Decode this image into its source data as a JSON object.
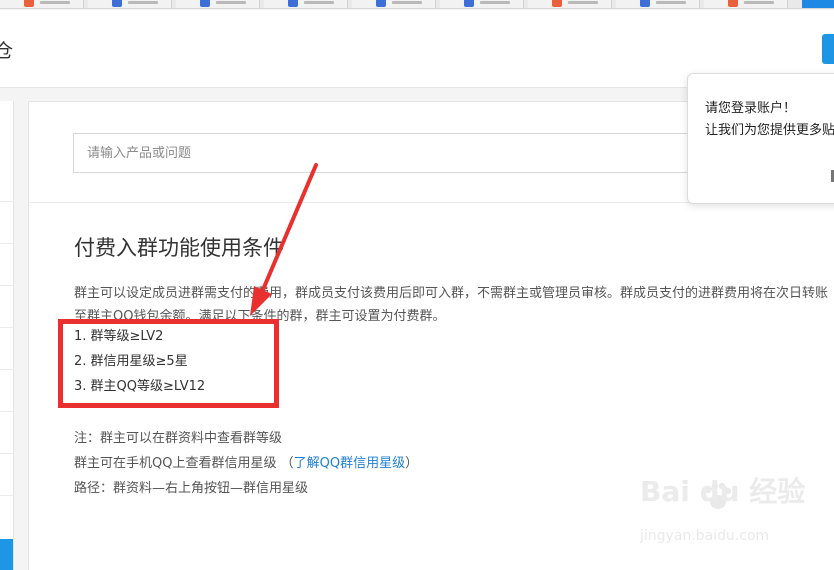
{
  "header": {
    "logo_fragment": "仓"
  },
  "search": {
    "placeholder": "请输入产品或问题"
  },
  "article": {
    "title": "付费入群功能使用条件",
    "intro": "群主可以设定成员进群需支付的费用，群成员支付该费用后即可入群，不需群主或管理员审核。群成员支付的进群费用将在次日转账至群主QQ钱包余额。满足以下条件的群，群主可设置为付费群。",
    "conditions": [
      "1. 群等级≥LV2",
      "2. 群信用星级≥5星",
      "3. 群主QQ等级≥LV12"
    ],
    "note_line1": "注：群主可以在群资料中查看群等级",
    "note_line2_prefix": "群主可在手机QQ上查看群信用星级 （",
    "note_line2_link": "了解QQ群信用星级",
    "note_line2_suffix": "）",
    "note_line3": "路径：群资料—右上角按钮—群信用星级"
  },
  "popup": {
    "line1": "请您登录账户！",
    "line2": "让我们为您提供更多贴心服务"
  },
  "watermark": {
    "brand": "Bai du 经验",
    "url": "jingyan.baidu.com"
  },
  "colors": {
    "accent": "#1e96e6",
    "annotation": "#e8302f",
    "link": "#1e7fd8"
  },
  "icons": [
    "browser-tab-favicon",
    "arrow-annotation",
    "baidu-paw-icon",
    "close-icon"
  ]
}
